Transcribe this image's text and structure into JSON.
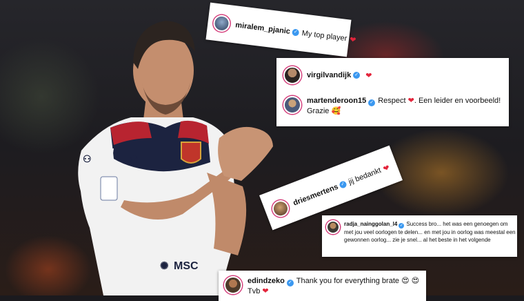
{
  "comments": [
    {
      "username": "miralem_pjanic",
      "verified": true,
      "text": "My top player",
      "heart": "❤"
    },
    {
      "username": "virgilvandijk",
      "verified": true,
      "text": "",
      "heart": "❤"
    },
    {
      "username": "martenderoon15",
      "verified": true,
      "text_before": "Respect",
      "heart": "❤",
      "text_after": ". Een leider en voorbeeld! Grazie",
      "emoji": "🥰"
    },
    {
      "username": "driesmertens",
      "verified": true,
      "text": "jij bedankt",
      "heart": "❤"
    },
    {
      "username": "radja_nainggolan_l4",
      "verified": true,
      "text": "Success bro... het was een genoegen om met jou veel oorlogen te delen... en met jou in oorlog was meestal een gewonnen oorlog... zie je snel... al het beste in het volgende"
    },
    {
      "username": "edindzeko",
      "verified": true,
      "text": "Thank you for everything brate",
      "emoji": "😍 😍",
      "text2": "Tvb",
      "heart": "❤"
    }
  ],
  "verified_mark": "✓",
  "colors": {
    "verified": "#3b98f0",
    "heart": "#e3243b",
    "avatar_ring": "#d43c7a"
  },
  "player": {
    "sponsor": "MSC",
    "kit_brand": "Kappa"
  }
}
